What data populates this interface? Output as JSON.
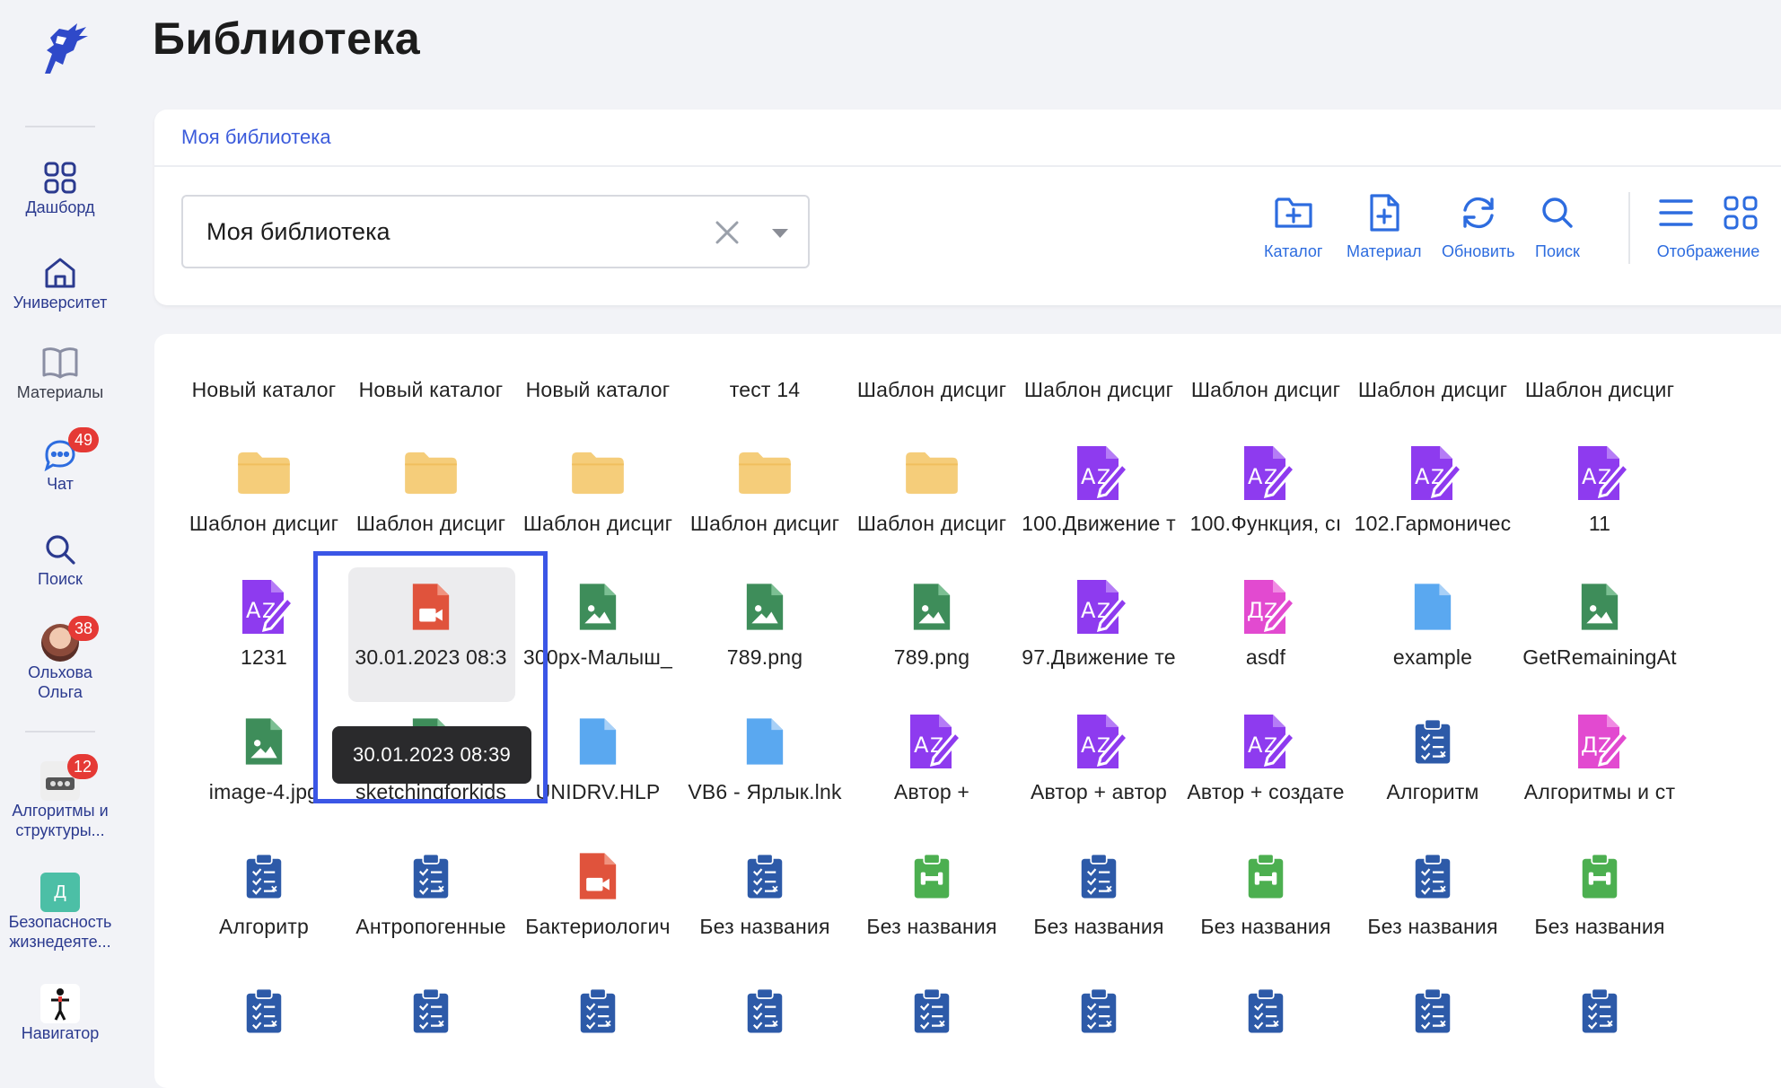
{
  "page": {
    "title": "Библиотека"
  },
  "sidebar": {
    "items": [
      {
        "label": "Дашборд",
        "icon": "dashboard-grid-icon"
      },
      {
        "label": "Университет",
        "icon": "university-home-icon"
      },
      {
        "label": "Материалы",
        "icon": "book-icon"
      },
      {
        "label": "Чат",
        "icon": "chat-icon",
        "badge": "49"
      },
      {
        "label": "Поиск",
        "icon": "search-icon"
      },
      {
        "label": "Ольхова Ольга",
        "icon": "avatar",
        "badge": "38"
      }
    ],
    "courses": [
      {
        "label": "Алгоритмы и структуры...",
        "badge": "12"
      },
      {
        "label": "Безопасность жизнедеяте...",
        "letter": "Д"
      },
      {
        "label": "Навигатор"
      }
    ]
  },
  "breadcrumb": "Моя библиотека",
  "library_select": {
    "value": "Моя библиотека"
  },
  "toolbar": {
    "catalog": "Каталог",
    "material": "Материал",
    "refresh": "Обновить",
    "search": "Поиск",
    "view": "Отображение"
  },
  "grid": {
    "top_labels": [
      "Новый каталог",
      "Новый каталог",
      "Новый каталог",
      "тест 14",
      "Шаблон дисциг",
      "Шаблон дисциг",
      "Шаблон дисциг",
      "Шаблон дисциг",
      "Шаблон дисциг"
    ],
    "rows": [
      [
        {
          "label": "Шаблон дисциг",
          "type": "folder"
        },
        {
          "label": "Шаблон дисциг",
          "type": "folder"
        },
        {
          "label": "Шаблон дисциг",
          "type": "folder"
        },
        {
          "label": "Шаблон дисциг",
          "type": "folder"
        },
        {
          "label": "Шаблон дисциг",
          "type": "folder"
        },
        {
          "label": "100.Движение т",
          "type": "az-purple"
        },
        {
          "label": "100.Функция, сı",
          "type": "az-purple"
        },
        {
          "label": "102.Гармоничес",
          "type": "az-purple"
        },
        {
          "label": "11",
          "type": "az-purple"
        }
      ],
      [
        {
          "label": "1231",
          "type": "az-purple"
        },
        {
          "label": "30.01.2023 08:3",
          "type": "video"
        },
        {
          "label": "300px-Малыш_",
          "type": "image"
        },
        {
          "label": "789.png",
          "type": "image"
        },
        {
          "label": "789.png",
          "type": "image"
        },
        {
          "label": "97.Движение те",
          "type": "az-purple"
        },
        {
          "label": "asdf",
          "type": "az-pink"
        },
        {
          "label": "example",
          "type": "file-blue"
        },
        {
          "label": "GetRemainingAt",
          "type": "image"
        }
      ],
      [
        {
          "label": "image-4.jpg",
          "type": "image"
        },
        {
          "label": "sketchingforkids",
          "type": "image"
        },
        {
          "label": "UNIDRV.HLP",
          "type": "file-blue"
        },
        {
          "label": "VB6 - Ярлык.lnk",
          "type": "file-blue"
        },
        {
          "label": "Автор +",
          "type": "az-purple"
        },
        {
          "label": "Автор + автор",
          "type": "az-purple"
        },
        {
          "label": "Автор + создате",
          "type": "az-purple"
        },
        {
          "label": "Алгоритм",
          "type": "test-blue"
        },
        {
          "label": "Алгоритмы и ст",
          "type": "az-pink"
        }
      ],
      [
        {
          "label": "Алгоритр",
          "type": "test-blue"
        },
        {
          "label": "Антропогенные",
          "type": "test-blue"
        },
        {
          "label": "Бактериологич",
          "type": "video"
        },
        {
          "label": "Без названия",
          "type": "test-blue"
        },
        {
          "label": "Без названия",
          "type": "test-green"
        },
        {
          "label": "Без названия",
          "type": "test-blue"
        },
        {
          "label": "Без названия",
          "type": "test-green"
        },
        {
          "label": "Без названия",
          "type": "test-blue"
        },
        {
          "label": "Без названия",
          "type": "test-green"
        }
      ],
      [
        {
          "label": "",
          "type": "test-blue"
        },
        {
          "label": "",
          "type": "test-blue"
        },
        {
          "label": "",
          "type": "test-blue"
        },
        {
          "label": "",
          "type": "test-blue"
        },
        {
          "label": "",
          "type": "test-blue"
        },
        {
          "label": "",
          "type": "test-blue"
        },
        {
          "label": "",
          "type": "test-blue"
        },
        {
          "label": "",
          "type": "test-blue"
        },
        {
          "label": "",
          "type": "test-blue"
        }
      ]
    ],
    "tooltip": "30.01.2023 08:39"
  },
  "colors": {
    "accent": "#2d6cdf",
    "folder": "#f5cd7a",
    "az_purple": "#8e3bef",
    "az_pink": "#e24ad0",
    "image_green": "#3e8d5a",
    "video_red": "#e0533c",
    "file_blue": "#5aa8f0",
    "test_blue": "#2d5aa8",
    "test_green": "#4caf50",
    "badge_red": "#e53935",
    "nav_text": "#2b3a8f"
  }
}
